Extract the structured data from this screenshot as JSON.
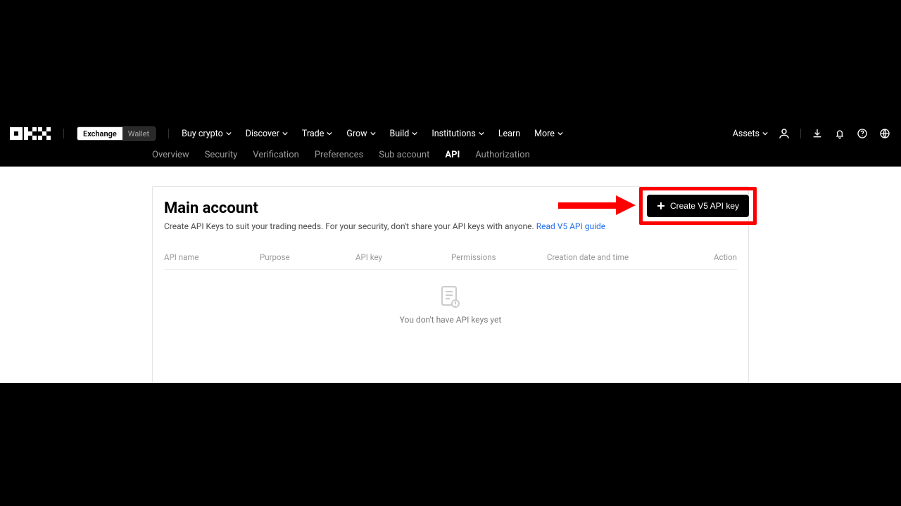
{
  "header": {
    "toggle": {
      "exchange": "Exchange",
      "wallet": "Wallet"
    },
    "nav": [
      {
        "label": "Buy crypto",
        "chev": true
      },
      {
        "label": "Discover",
        "chev": true
      },
      {
        "label": "Trade",
        "chev": true
      },
      {
        "label": "Grow",
        "chev": true
      },
      {
        "label": "Build",
        "chev": true
      },
      {
        "label": "Institutions",
        "chev": true
      },
      {
        "label": "Learn",
        "chev": false
      },
      {
        "label": "More",
        "chev": true
      }
    ],
    "assets_label": "Assets"
  },
  "subnav": {
    "items": [
      "Overview",
      "Security",
      "Verification",
      "Preferences",
      "Sub account",
      "API",
      "Authorization"
    ],
    "active_index": 5
  },
  "card": {
    "title": "Main account",
    "desc": "Create API Keys to suit your trading needs. For your security, don't share your API keys with anyone. ",
    "link": "Read V5 API guide",
    "create_btn": "Create V5 API key"
  },
  "table": {
    "columns": [
      "API name",
      "Purpose",
      "API key",
      "Permissions",
      "Creation date and time",
      "Action"
    ]
  },
  "empty": {
    "text": "You don't have API keys yet"
  }
}
